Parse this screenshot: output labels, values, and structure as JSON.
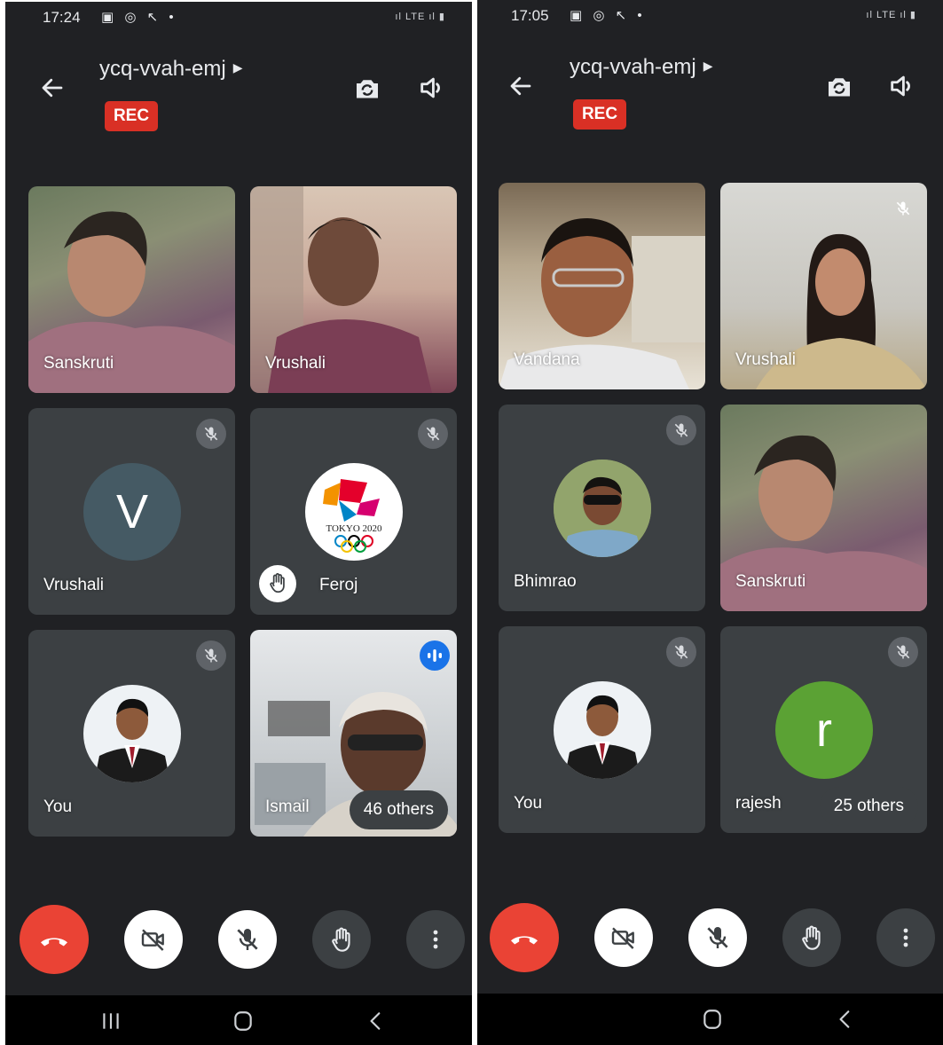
{
  "left": {
    "status": {
      "time": "17:24",
      "icons": "▣ ◎ ↖ •",
      "right": "ıl LTE ıl ▮"
    },
    "meeting": {
      "title": "ycq-vvah-emj",
      "rec": "REC"
    },
    "tiles": [
      {
        "name": "Sanskruti",
        "kind": "video"
      },
      {
        "name": "Vrushali",
        "kind": "video"
      },
      {
        "name": "Vrushali",
        "kind": "letter",
        "letter": "V",
        "muted": true
      },
      {
        "name": "Feroj",
        "kind": "logo",
        "logo_text": "TOKYO 2020",
        "muted": true,
        "hand_raised": true
      },
      {
        "name": "You",
        "kind": "photo",
        "muted": true
      },
      {
        "name": "Ismail",
        "kind": "video",
        "speaking": true,
        "others": "46 others"
      }
    ]
  },
  "right": {
    "status": {
      "time": "17:05",
      "icons": "▣ ◎ ↖ •",
      "right": "ıl LTE ıl ▮"
    },
    "meeting": {
      "title": "ycq-vvah-emj",
      "rec": "REC"
    },
    "tiles": [
      {
        "name": "Vandana",
        "kind": "video"
      },
      {
        "name": "Vrushali",
        "kind": "video",
        "muted": true
      },
      {
        "name": "Bhimrao",
        "kind": "photo",
        "muted": true
      },
      {
        "name": "Sanskruti",
        "kind": "video"
      },
      {
        "name": "You",
        "kind": "photo",
        "muted": true
      },
      {
        "name": "rajesh",
        "kind": "letter",
        "letter": "r",
        "muted": true,
        "others": "25 others"
      }
    ]
  },
  "colors": {
    "background": "#202124",
    "tile": "#3c4043",
    "rec": "#d93025",
    "end_call": "#ea4335",
    "avatar_v": "#455a64",
    "avatar_r": "#5ba234",
    "speaking": "#1a73e8"
  },
  "icons": {
    "header": [
      "back-arrow-icon",
      "switch-camera-icon",
      "speaker-icon"
    ],
    "controls": [
      "end-call-icon",
      "camera-off-icon",
      "mic-off-icon",
      "raise-hand-icon",
      "more-options-icon"
    ],
    "nav": [
      "recent-apps-icon",
      "home-icon",
      "back-icon"
    ]
  }
}
